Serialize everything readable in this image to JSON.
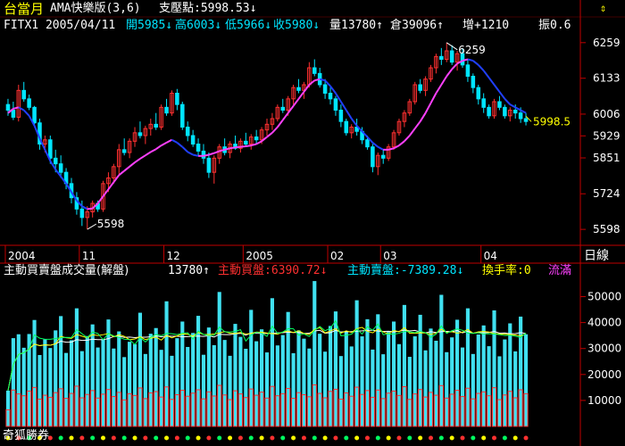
{
  "colors": {
    "bg": "#000000",
    "frame": "#c00000",
    "up_candle": "#ff3030",
    "down_candle": "#00e5ff",
    "ama_up": "#ff40ff",
    "ama_down": "#2040ff",
    "yellow": "#ffff00",
    "white": "#ffffff",
    "cyan": "#00e5ff",
    "red": "#ff3030",
    "magenta": "#ff40ff",
    "vol_up": "#ff3030",
    "vol_down": "#40e0f0",
    "ma_white": "#ffffff",
    "ma_yellow": "#ffff00",
    "ma_green": "#00ff60"
  },
  "header": {
    "title": "台當月",
    "indicator": "AMA快樂版(3,6)",
    "support_label": "支壓點:5998.53↓",
    "symbol_date": "FITX1 2005/04/11",
    "open": "開5985↓",
    "high": "高6003↓",
    "low": "低5966↓",
    "close": "收5980↓",
    "volume": "量13780↑",
    "oi": "倉39096↑",
    "oi_change": "增+1210",
    "amplitude": "振0.6"
  },
  "volume_header": {
    "label": "主動買賣盤成交量(解盤)",
    "value": "13780↑",
    "buy": "主動買盤:6390.72↓",
    "sell": "主動賣盤:-7389.28↓",
    "turnover": "換手率:0",
    "flow": "流滿"
  },
  "footer_brand": "奇狐勝券",
  "period_label": "日線",
  "chart_data": [
    {
      "type": "candlestick",
      "title": "台當月 AMA快樂版(3,6)",
      "y_ticks": [
        6259,
        6133,
        6006,
        5929,
        5851,
        5724,
        5598
      ],
      "ylim": [
        5570,
        6290
      ],
      "x_ticks": [
        "2004",
        "11",
        "12",
        "2005",
        "02",
        "03",
        "04"
      ],
      "annotations": [
        {
          "label": "6259",
          "value": 6259
        },
        {
          "label": "5598",
          "value": 5598
        },
        {
          "label": "5998.5",
          "value": 5998.5
        }
      ],
      "ohlc": [
        [
          6040,
          6060,
          6000,
          6020
        ],
        [
          6020,
          6050,
          5985,
          5995
        ],
        [
          5995,
          6110,
          5980,
          6090
        ],
        [
          6090,
          6120,
          6050,
          6060
        ],
        [
          6060,
          6075,
          6020,
          6030
        ],
        [
          6030,
          6035,
          5960,
          5975
        ],
        [
          5975,
          5990,
          5880,
          5900
        ],
        [
          5900,
          5930,
          5870,
          5915
        ],
        [
          5915,
          5930,
          5830,
          5850
        ],
        [
          5850,
          5880,
          5800,
          5830
        ],
        [
          5830,
          5860,
          5780,
          5800
        ],
        [
          5800,
          5815,
          5740,
          5760
        ],
        [
          5760,
          5780,
          5690,
          5710
        ],
        [
          5710,
          5730,
          5650,
          5670
        ],
        [
          5670,
          5700,
          5610,
          5640
        ],
        [
          5640,
          5680,
          5598,
          5660
        ],
        [
          5660,
          5700,
          5640,
          5690
        ],
        [
          5690,
          5700,
          5660,
          5670
        ],
        [
          5670,
          5770,
          5660,
          5760
        ],
        [
          5760,
          5800,
          5730,
          5780
        ],
        [
          5780,
          5830,
          5760,
          5820
        ],
        [
          5820,
          5900,
          5790,
          5880
        ],
        [
          5880,
          5920,
          5860,
          5870
        ],
        [
          5870,
          5920,
          5850,
          5910
        ],
        [
          5910,
          5960,
          5890,
          5940
        ],
        [
          5940,
          5980,
          5920,
          5930
        ],
        [
          5930,
          5965,
          5900,
          5955
        ],
        [
          5955,
          5990,
          5930,
          5970
        ],
        [
          5970,
          6010,
          5950,
          5960
        ],
        [
          5960,
          6040,
          5950,
          6030
        ],
        [
          6030,
          6060,
          6000,
          6010
        ],
        [
          6010,
          6090,
          6000,
          6080
        ],
        [
          6080,
          6095,
          6020,
          6040
        ],
        [
          6040,
          6050,
          5950,
          5960
        ],
        [
          5960,
          5980,
          5910,
          5930
        ],
        [
          5930,
          5950,
          5890,
          5900
        ],
        [
          5900,
          5920,
          5860,
          5875
        ],
        [
          5875,
          5900,
          5830,
          5850
        ],
        [
          5850,
          5870,
          5780,
          5800
        ],
        [
          5800,
          5860,
          5760,
          5850
        ],
        [
          5850,
          5900,
          5830,
          5890
        ],
        [
          5890,
          5920,
          5860,
          5870
        ],
        [
          5870,
          5910,
          5850,
          5900
        ],
        [
          5900,
          5930,
          5880,
          5885
        ],
        [
          5885,
          5920,
          5870,
          5910
        ],
        [
          5910,
          5940,
          5890,
          5900
        ],
        [
          5900,
          5935,
          5880,
          5925
        ],
        [
          5925,
          5950,
          5900,
          5915
        ],
        [
          5915,
          5960,
          5900,
          5950
        ],
        [
          5950,
          5990,
          5930,
          5970
        ],
        [
          5970,
          6010,
          5950,
          5990
        ],
        [
          5990,
          6040,
          5980,
          6030
        ],
        [
          6030,
          6060,
          6010,
          6020
        ],
        [
          6020,
          6070,
          6000,
          6060
        ],
        [
          6060,
          6110,
          6040,
          6100
        ],
        [
          6100,
          6130,
          6080,
          6090
        ],
        [
          6090,
          6120,
          6060,
          6110
        ],
        [
          6110,
          6190,
          6100,
          6170
        ],
        [
          6170,
          6200,
          6140,
          6150
        ],
        [
          6150,
          6170,
          6100,
          6110
        ],
        [
          6110,
          6130,
          6060,
          6080
        ],
        [
          6080,
          6100,
          6040,
          6060
        ],
        [
          6060,
          6070,
          6000,
          6020
        ],
        [
          6020,
          6040,
          5960,
          5980
        ],
        [
          5980,
          5990,
          5930,
          5940
        ],
        [
          5940,
          5970,
          5920,
          5960
        ],
        [
          5960,
          5990,
          5930,
          5945
        ],
        [
          5945,
          5960,
          5900,
          5915
        ],
        [
          5915,
          5930,
          5880,
          5890
        ],
        [
          5890,
          5900,
          5800,
          5820
        ],
        [
          5820,
          5870,
          5790,
          5860
        ],
        [
          5860,
          5880,
          5830,
          5850
        ],
        [
          5850,
          5900,
          5840,
          5890
        ],
        [
          5890,
          5950,
          5880,
          5940
        ],
        [
          5940,
          5990,
          5930,
          5980
        ],
        [
          5980,
          6020,
          5960,
          6010
        ],
        [
          6010,
          6060,
          6000,
          6050
        ],
        [
          6050,
          6120,
          6040,
          6110
        ],
        [
          6110,
          6130,
          6080,
          6090
        ],
        [
          6090,
          6140,
          6070,
          6130
        ],
        [
          6130,
          6180,
          6120,
          6170
        ],
        [
          6170,
          6220,
          6150,
          6210
        ],
        [
          6210,
          6240,
          6180,
          6200
        ],
        [
          6200,
          6259,
          6190,
          6230
        ],
        [
          6230,
          6250,
          6180,
          6190
        ],
        [
          6190,
          6230,
          6160,
          6220
        ],
        [
          6220,
          6240,
          6170,
          6180
        ],
        [
          6180,
          6200,
          6120,
          6140
        ],
        [
          6140,
          6150,
          6080,
          6100
        ],
        [
          6100,
          6110,
          6040,
          6060
        ],
        [
          6060,
          6080,
          6010,
          6030
        ],
        [
          6030,
          6040,
          5990,
          6000
        ],
        [
          6000,
          6060,
          5990,
          6050
        ],
        [
          6050,
          6070,
          6020,
          6030
        ],
        [
          6030,
          6040,
          5990,
          6000
        ],
        [
          6000,
          6030,
          5980,
          6020
        ],
        [
          6020,
          6040,
          5990,
          6010
        ],
        [
          6010,
          6030,
          5975,
          5990
        ],
        [
          5990,
          6010,
          5966,
          5980
        ]
      ],
      "ama": [
        6010,
        6025,
        6030,
        6020,
        6000,
        5965,
        5920,
        5880,
        5840,
        5810,
        5785,
        5760,
        5730,
        5700,
        5680,
        5670,
        5672,
        5690,
        5715,
        5740,
        5765,
        5790,
        5805,
        5820,
        5835,
        5848,
        5860,
        5872,
        5882,
        5895,
        5905,
        5915,
        5905,
        5890,
        5872,
        5862,
        5858,
        5858,
        5862,
        5868,
        5875,
        5880,
        5885,
        5888,
        5890,
        5892,
        5895,
        5900,
        5910,
        5925,
        5940,
        5960,
        5985,
        6010,
        6035,
        6060,
        6085,
        6110,
        6125,
        6130,
        6125,
        6105,
        6080,
        6050,
        6020,
        5990,
        5965,
        5945,
        5925,
        5905,
        5890,
        5880,
        5880,
        5885,
        5895,
        5910,
        5930,
        5955,
        5980,
        6010,
        6045,
        6080,
        6110,
        6140,
        6165,
        6185,
        6195,
        6200,
        6195,
        6180,
        6160,
        6135,
        6110,
        6085,
        6060,
        6040,
        6030,
        6020,
        6010,
        6005,
        6000,
        5998.5
      ]
    },
    {
      "type": "bar",
      "title": "主動買賣盤成交量(解盤)",
      "y_ticks": [
        50000,
        40000,
        30000,
        20000,
        10000
      ],
      "ylim": [
        0,
        55000
      ],
      "series": [
        {
          "name": "主動買盤",
          "values": [
            6390,
            14000,
            12500,
            11800,
            13600,
            15000,
            10500,
            12000,
            11200,
            13000,
            14500,
            10800,
            12700,
            15500,
            11000,
            12300,
            13800,
            10900,
            12400,
            14200,
            11500,
            13100,
            10200,
            12600,
            11900,
            14800,
            10700,
            12900,
            13400,
            11300,
            15200,
            10400,
            12200,
            13900,
            11600,
            12800,
            14100,
            10600,
            13300,
            11700,
            15800,
            12100,
            10300,
            13700,
            12500,
            11100,
            14400,
            12000,
            13200,
            10900,
            15400,
            11800,
            12600,
            14600,
            10800,
            13000,
            12200,
            11400,
            16000,
            12700,
            11000,
            13500,
            14300,
            10500,
            12900,
            11600,
            15100,
            12300,
            13800,
            11200,
            14000,
            10700,
            12800,
            13600,
            11900,
            15300,
            10400,
            12500,
            14200,
            11300,
            13100,
            12000,
            15700,
            10900,
            12400,
            13900,
            11500,
            14700,
            10600,
            12700,
            13300,
            11800,
            14900,
            10300,
            12100,
            13500,
            11000,
            14100,
            12600,
            10800,
            13700,
            9500
          ]
        },
        {
          "name": "主動賣盤",
          "values": [
            7390,
            20000,
            23000,
            18500,
            22000,
            26000,
            17000,
            21500,
            19000,
            24000,
            28000,
            17500,
            20500,
            30000,
            18000,
            22500,
            25500,
            19500,
            21000,
            27000,
            18500,
            23500,
            16500,
            20000,
            19800,
            29000,
            17200,
            22800,
            24500,
            18200,
            33000,
            16800,
            21800,
            26500,
            19000,
            23200,
            28500,
            17000,
            24800,
            19600,
            36000,
            21200,
            16900,
            25800,
            22000,
            18800,
            30500,
            20800,
            24200,
            17600,
            34000,
            19400,
            22600,
            29500,
            17400,
            24000,
            21600,
            18600,
            40000,
            23000,
            17800,
            25200,
            30000,
            16600,
            23800,
            19200,
            33500,
            22400,
            27500,
            18400,
            29200,
            17100,
            23600,
            26800,
            19800,
            31500,
            16400,
            22200,
            28800,
            18000,
            24600,
            21000,
            35000,
            17700,
            21900,
            27200,
            18900,
            30800,
            17300,
            22700,
            25600,
            19100,
            29800,
            16700,
            21400,
            26200,
            17900,
            28200,
            22900,
            16800,
            25900,
            14500
          ]
        }
      ]
    }
  ]
}
